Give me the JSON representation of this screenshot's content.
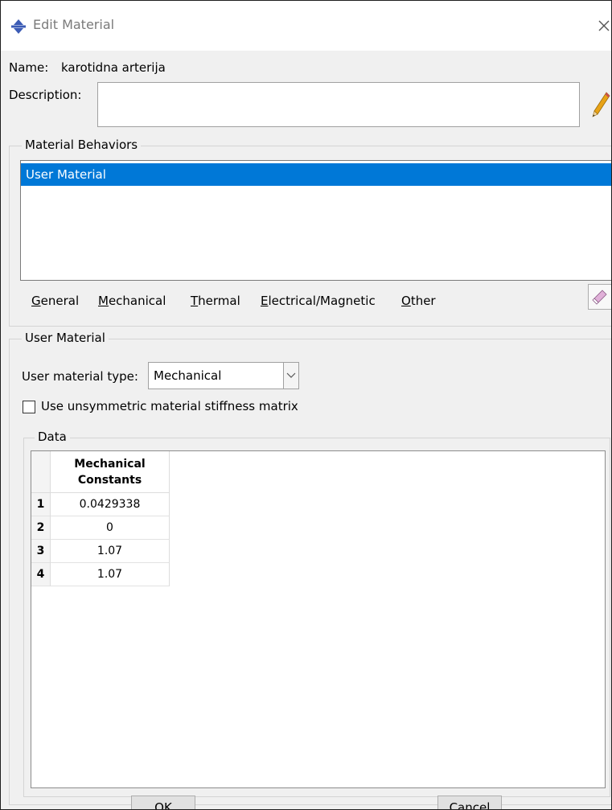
{
  "window": {
    "title": "Edit Material"
  },
  "name": {
    "label": "Name:",
    "value": "karotidna arterija"
  },
  "description": {
    "label": "Description:",
    "value": ""
  },
  "behaviors": {
    "group_label": "Material Behaviors",
    "items": [
      {
        "label": "User Material",
        "selected": true
      }
    ],
    "menus": [
      {
        "mnemonic": "G",
        "rest": "eneral"
      },
      {
        "mnemonic": "M",
        "rest": "echanical"
      },
      {
        "mnemonic": "T",
        "rest": "hermal"
      },
      {
        "mnemonic": "E",
        "rest": "lectrical/Magnetic"
      },
      {
        "mnemonic": "O",
        "rest": "ther"
      }
    ]
  },
  "user_material": {
    "group_label": "User Material",
    "type_label": "User material type:",
    "type_value": "Mechanical",
    "unsymmetric_label": "Use unsymmetric material stiffness matrix",
    "unsymmetric_checked": false,
    "data": {
      "group_label": "Data",
      "column_header_line1": "Mechanical",
      "column_header_line2": "Constants",
      "rows": [
        {
          "index": "1",
          "value": "0.0429338"
        },
        {
          "index": "2",
          "value": "0"
        },
        {
          "index": "3",
          "value": "1.07"
        },
        {
          "index": "4",
          "value": "1.07"
        }
      ]
    }
  },
  "buttons": {
    "ok": "OK",
    "cancel": "Cancel"
  },
  "colors": {
    "selection": "#0078d7",
    "title_text": "#7a7a7a",
    "dialog_bg": "#f0f0f0"
  },
  "icons": {
    "app": "abaqus-logo-icon",
    "close": "close-icon",
    "edit": "pencil-icon",
    "clear": "eraser-icon"
  }
}
